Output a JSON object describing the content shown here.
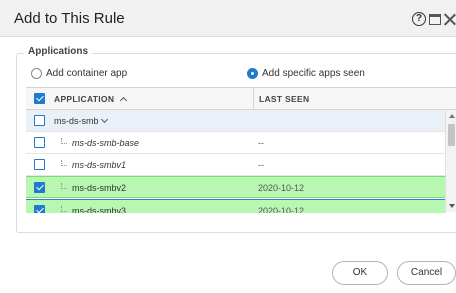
{
  "dialog": {
    "title": "Add to This Rule"
  },
  "applications": {
    "legend": "Applications",
    "radio_container_label": "Add container app",
    "radio_specific_label": "Add specific apps seen",
    "columns": {
      "application": "APPLICATION",
      "last_seen": "LAST SEEN"
    },
    "rows": [
      {
        "name": "ms-ds-smb",
        "last_seen": "",
        "checked": false,
        "kind": "group"
      },
      {
        "name": "ms-ds-smb-base",
        "last_seen": "--",
        "checked": false,
        "kind": "child"
      },
      {
        "name": "ms-ds-smbv1",
        "last_seen": "--",
        "checked": false,
        "kind": "child"
      },
      {
        "name": "ms-ds-smbv2",
        "last_seen": "2020-10-12",
        "checked": true,
        "kind": "child"
      },
      {
        "name": "ms-ds-smbv3",
        "last_seen": "2020-10-12",
        "checked": true,
        "kind": "child"
      }
    ]
  },
  "footer": {
    "ok_label": "OK",
    "cancel_label": "Cancel"
  },
  "colors": {
    "accent": "#1f7ad1",
    "selected_row": "#b8f7b1"
  }
}
